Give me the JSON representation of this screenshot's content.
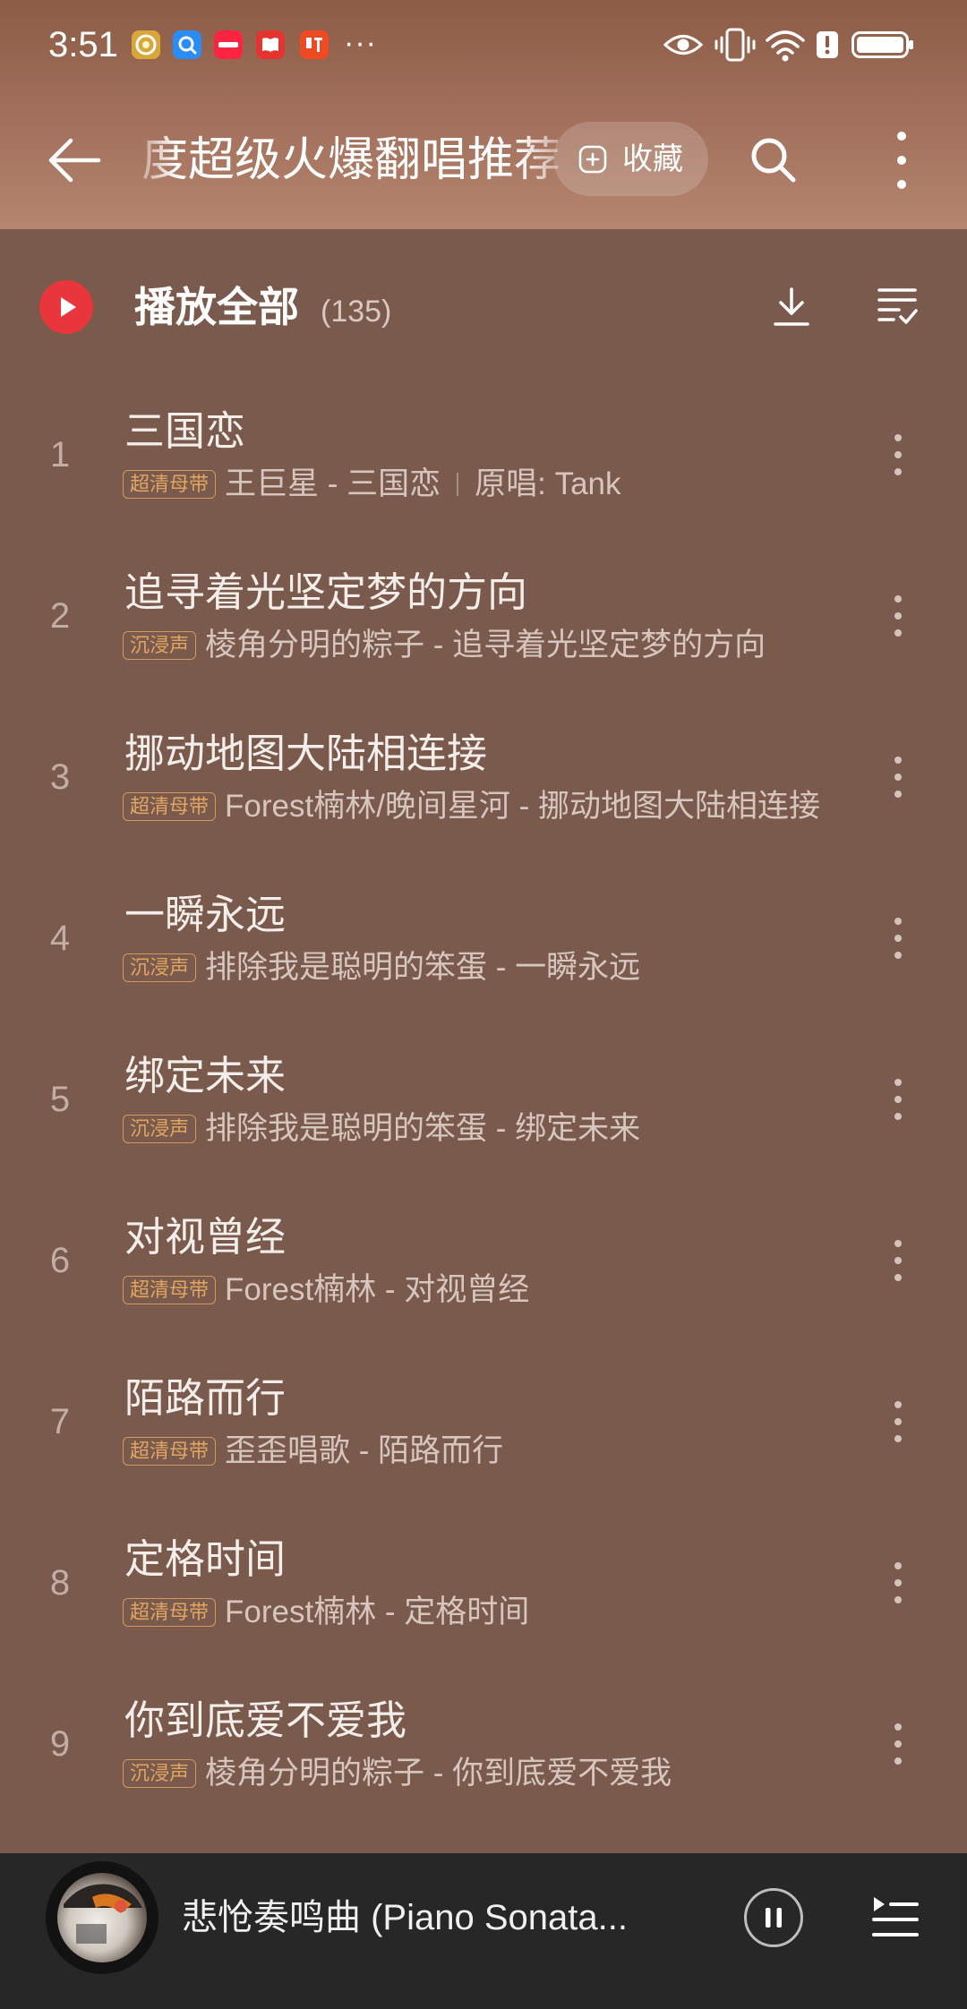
{
  "status_bar": {
    "time": "3:51",
    "more_notifications": "···",
    "notification_icons": [
      "coin-app-icon",
      "search-app-icon",
      "red-note-app-icon",
      "book-app-icon",
      "listen-app-icon"
    ],
    "system_icons": [
      "eye-icon",
      "vibrate-icon",
      "wifi-icon",
      "alert-icon",
      "battery-icon"
    ]
  },
  "header": {
    "title": "度超级火爆翻唱推荐",
    "collect_label": "收藏",
    "icons": [
      "back-arrow-icon",
      "add-collection-icon",
      "search-icon",
      "more-vertical-icon"
    ]
  },
  "play_all": {
    "label": "播放全部",
    "count": "(135)",
    "icons": [
      "play-circle-icon",
      "download-icon",
      "multi-select-icon"
    ]
  },
  "songs": [
    {
      "index": 1,
      "title": "三国恋",
      "tag": "超清母带",
      "subtitle": "王巨星 - 三国恋",
      "original": "原唱: Tank"
    },
    {
      "index": 2,
      "title": "追寻着光坚定梦的方向",
      "tag": "沉浸声",
      "subtitle": "棱角分明的粽子 - 追寻着光坚定梦的方向"
    },
    {
      "index": 3,
      "title": "挪动地图大陆相连接",
      "tag": "超清母带",
      "subtitle": "Forest楠林/晚间星河 - 挪动地图大陆相连接"
    },
    {
      "index": 4,
      "title": "一瞬永远",
      "tag": "沉浸声",
      "subtitle": "排除我是聪明的笨蛋 - 一瞬永远"
    },
    {
      "index": 5,
      "title": "绑定未来",
      "tag": "沉浸声",
      "subtitle": "排除我是聪明的笨蛋 - 绑定未来"
    },
    {
      "index": 6,
      "title": "对视曾经",
      "tag": "超清母带",
      "subtitle": "Forest楠林 - 对视曾经"
    },
    {
      "index": 7,
      "title": "陌路而行",
      "tag": "超清母带",
      "subtitle": "歪歪唱歌 - 陌路而行"
    },
    {
      "index": 8,
      "title": "定格时间",
      "tag": "超清母带",
      "subtitle": "Forest楠林 - 定格时间"
    },
    {
      "index": 9,
      "title": "你到底爱不爱我",
      "tag": "沉浸声",
      "subtitle": "棱角分明的粽子 - 你到底爱不爱我"
    }
  ],
  "now_playing": {
    "title": "悲怆奏鸣曲 (Piano Sonata...",
    "icons": [
      "album-art",
      "pause-icon",
      "playlist-icon"
    ]
  },
  "colors": {
    "header_gradient_top": "#8c5c46",
    "header_gradient_bottom": "#b5866f",
    "list_background": "#7a5a4d",
    "play_red": "#e8363c",
    "tag_gold": "#e0a561",
    "mini_player_background": "#272727"
  }
}
